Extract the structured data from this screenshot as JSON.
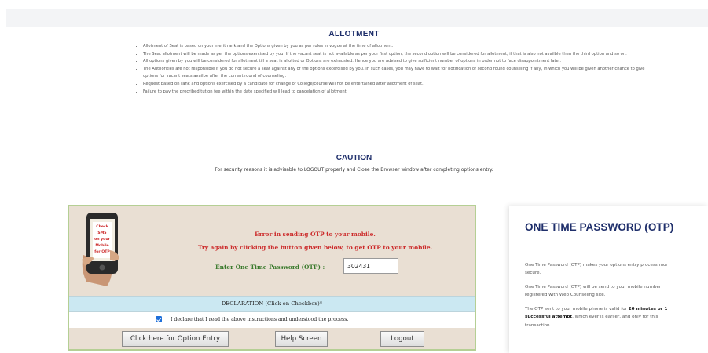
{
  "allotment": {
    "heading": "ALLOTMENT",
    "rules": [
      "Allotment of Seat is based on your merit rank and the Options given by you as per rules in vogue at the time of allotment.",
      "The Seat allotment will be made as per the options exercised by you. If the vacant seat is not available as per your first option, the second option will be considered for allotment, if that is also not availble then the third option and so on.",
      "All options given by you will be considered for allotment till a seat is allotted or Options are exhausted. Hence you are advised to give sufficient number of options in order not to face disappointment later.",
      "The Authorities are not responsible if you do not secure a seat against any of the options excercised by you. In such cases, you may have to wait for notification of second round counseling if any, in which you will be given another chance to give options for vacant seats availbe after the current round of counseling.",
      "Request based on rank and options exercised by a candidate for change of College/course will not be entertained after allotment of seat.",
      "Failure to pay the precribed tution fee within the date specified will lead to cancelation of allotment."
    ]
  },
  "caution": {
    "heading": "CAUTION",
    "text": "For security reasons it is advisable to LOGOUT properly and Close the Browser window after completing options entry."
  },
  "otp_panel": {
    "phone_caption": [
      "Check",
      "SMS",
      "on your",
      "Mobile",
      "for OTP"
    ],
    "error_line1": "Error in sending OTP to your mobile.",
    "error_line2": "Try again by clicking the button given below, to get OTP to your mobile.",
    "otp_label": "Enter One Time Password (OTP) :",
    "otp_value": "302431",
    "declaration_header": "DECLARATION (Click on Checkbox)*",
    "declaration_text": "I declare that I read the above instructions and understood the process.",
    "declaration_checked": true,
    "buttons": {
      "option_entry": "Click here for Option Entry",
      "help": "Help Screen",
      "logout": "Logout"
    }
  },
  "otp_info": {
    "title": "ONE TIME PASSWORD (OTP)",
    "p1_lines": [
      "One Time Password (OTP) makes your options entry process mor",
      "secure."
    ],
    "p2_lines": [
      "One Time Password (OTP) will be send to your mobile number",
      "registered with Web Counseling site."
    ],
    "p3_parts": {
      "a": "The OTP sent to your mobile phone is valid for ",
      "b": "20 minutes or 1",
      "c": "successful attempt",
      "d": ", which ever is earlier, and only for this",
      "e": "transaction."
    }
  },
  "colors": {
    "heading_navy": "#1f2f6b",
    "error_red": "#cc2a2a",
    "label_green": "#3a7a2c",
    "panel_beige": "#e9dfd3",
    "declaration_blue": "#cbe8f2",
    "panel_border": "#b5cf94"
  }
}
